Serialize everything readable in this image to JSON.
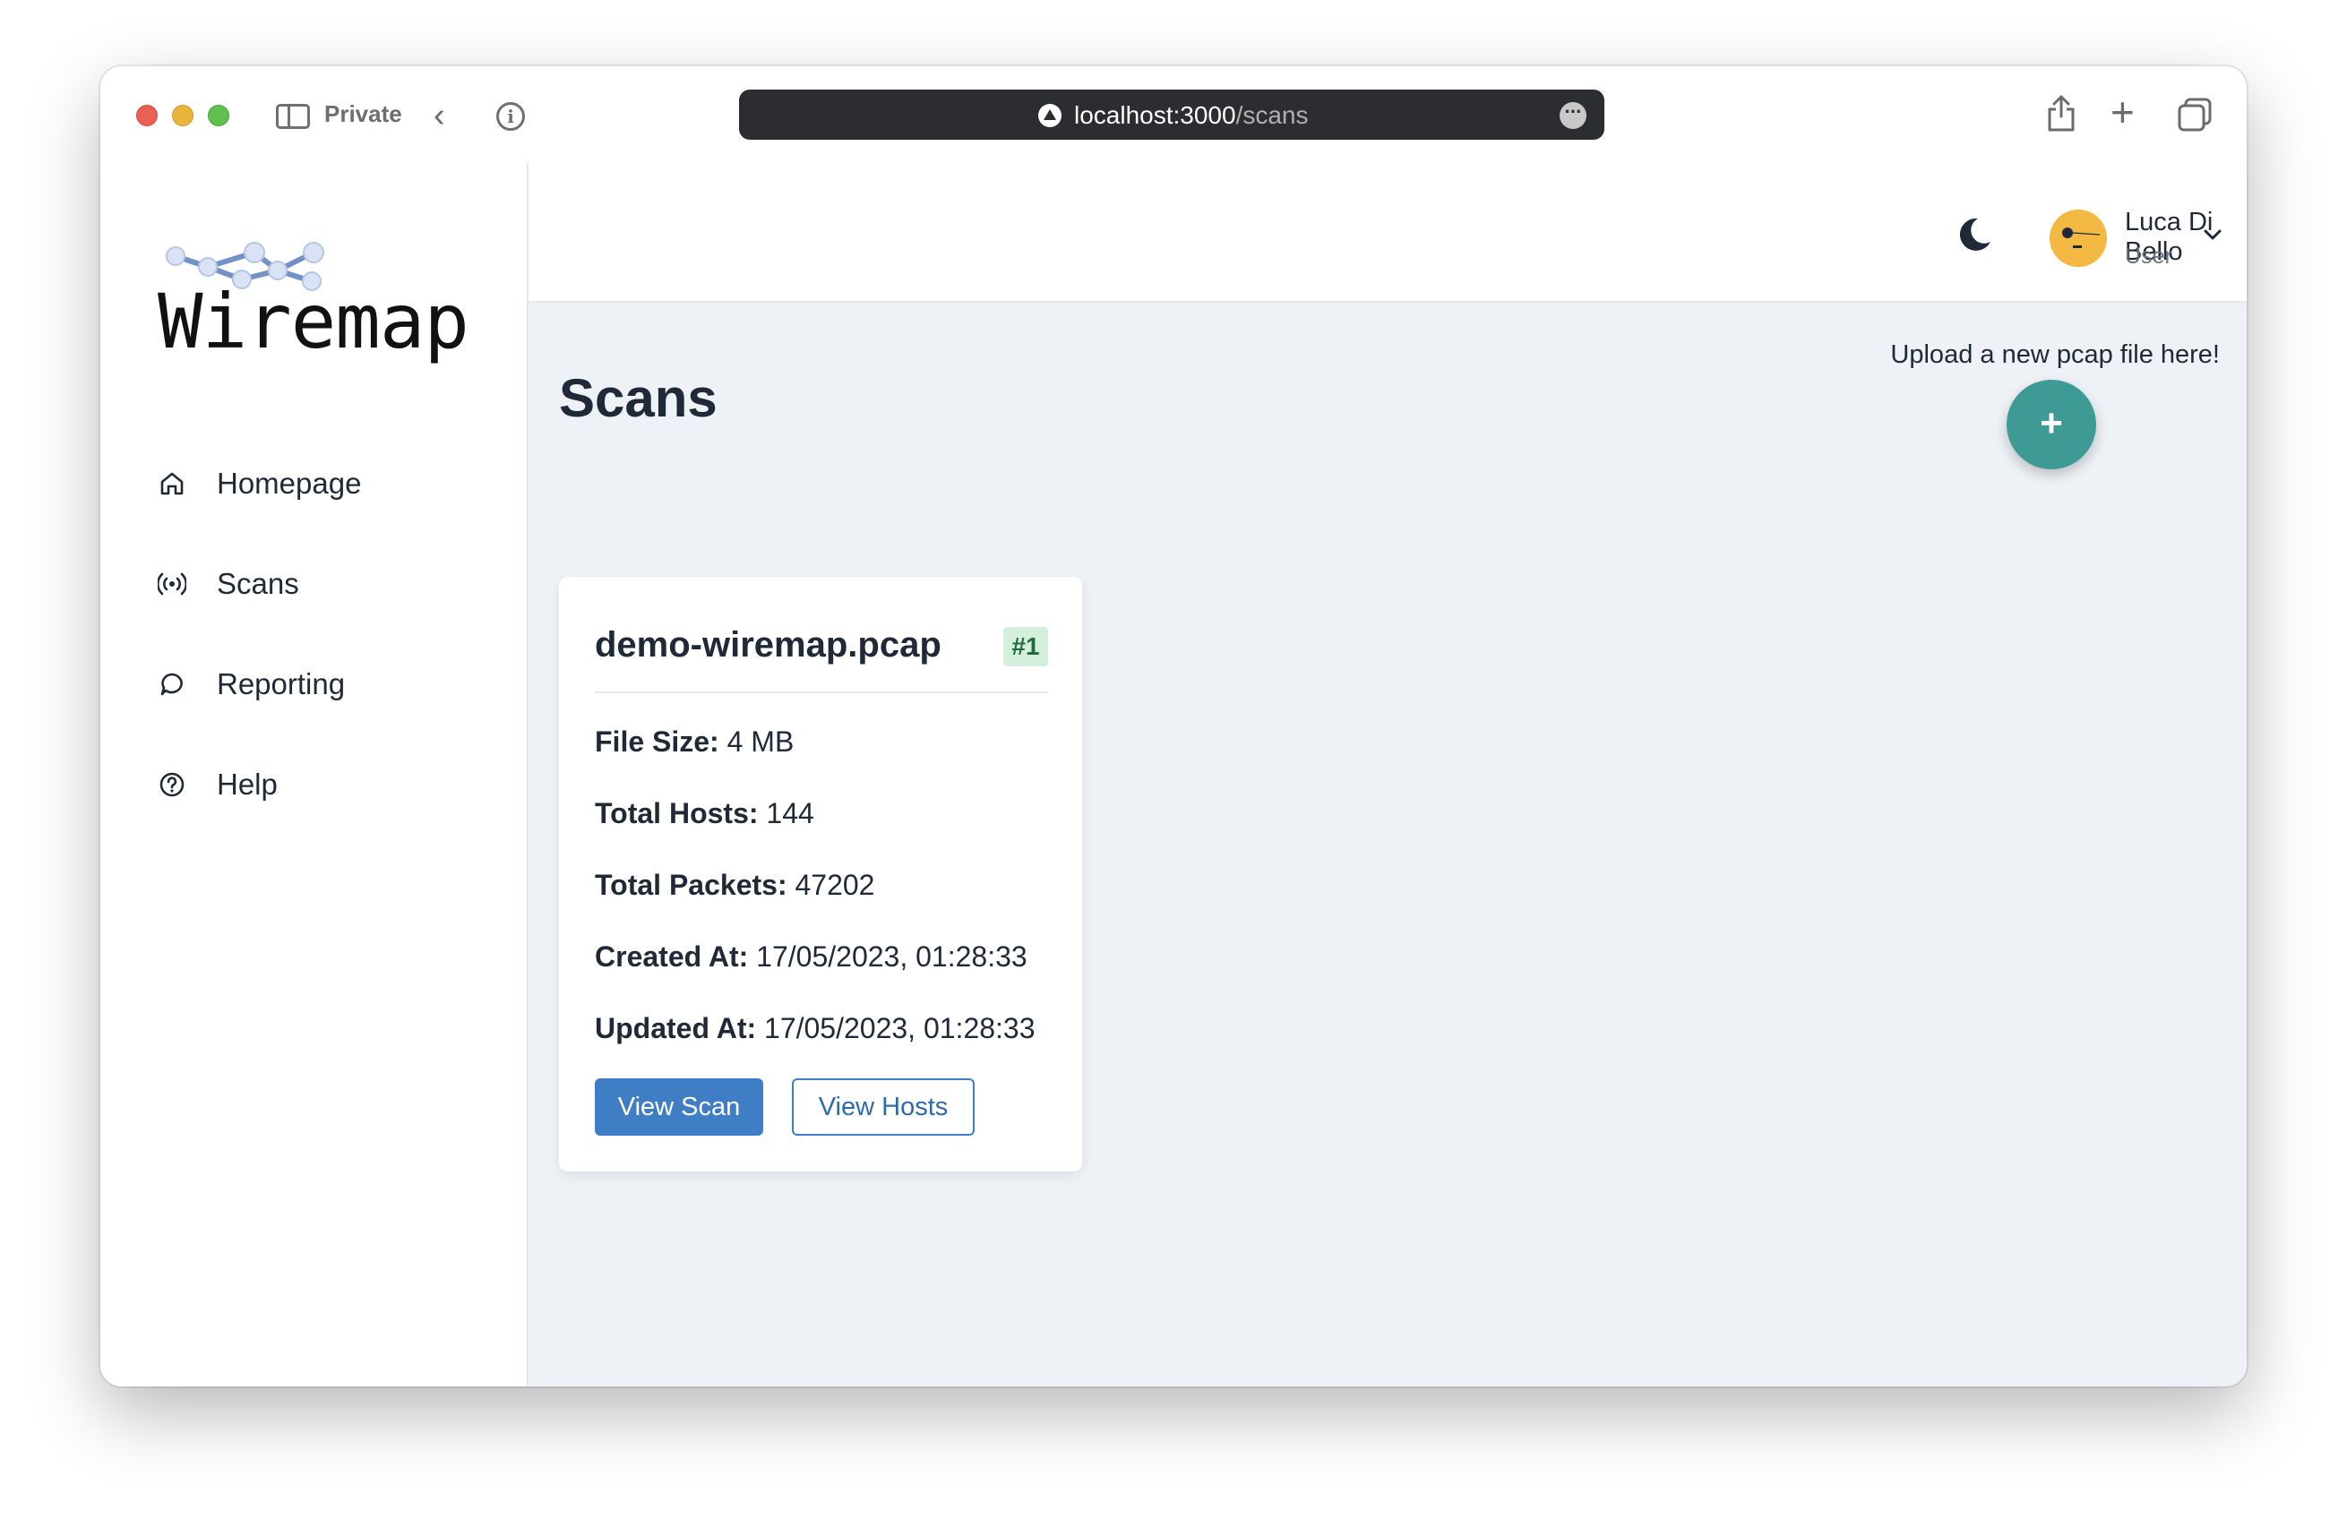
{
  "browser": {
    "private_label": "Private",
    "url_host": "localhost:3000",
    "url_path": "/scans"
  },
  "app": {
    "logo_text": "Wiremap"
  },
  "sidebar": {
    "items": [
      {
        "label": "Homepage",
        "icon": "home-icon"
      },
      {
        "label": "Scans",
        "icon": "broadcast-icon"
      },
      {
        "label": "Reporting",
        "icon": "chat-bubble-icon"
      },
      {
        "label": "Help",
        "icon": "question-circle-icon"
      }
    ]
  },
  "header": {
    "theme_icon": "moon-icon",
    "user_name": "Luca Di Bello",
    "user_role": "User"
  },
  "main": {
    "title": "Scans",
    "upload_hint": "Upload a new pcap file here!",
    "fab_label": "+",
    "scans": [
      {
        "name": "demo-wiremap.pcap",
        "badge": "#1",
        "file_size_label": "File Size:",
        "file_size": "4 MB",
        "total_hosts_label": "Total Hosts:",
        "total_hosts": "144",
        "total_packets_label": "Total Packets:",
        "total_packets": "47202",
        "created_label": "Created At:",
        "created_at": "17/05/2023, 01:28:33",
        "updated_label": "Updated At:",
        "updated_at": "17/05/2023, 01:28:33",
        "view_scan_label": "View Scan",
        "view_hosts_label": "View Hosts"
      }
    ]
  },
  "colors": {
    "accent_blue": "#3f7ec4",
    "fab_teal": "#3e9a94",
    "badge_green_bg": "#d4f0dc",
    "main_bg": "#eef1f6"
  }
}
